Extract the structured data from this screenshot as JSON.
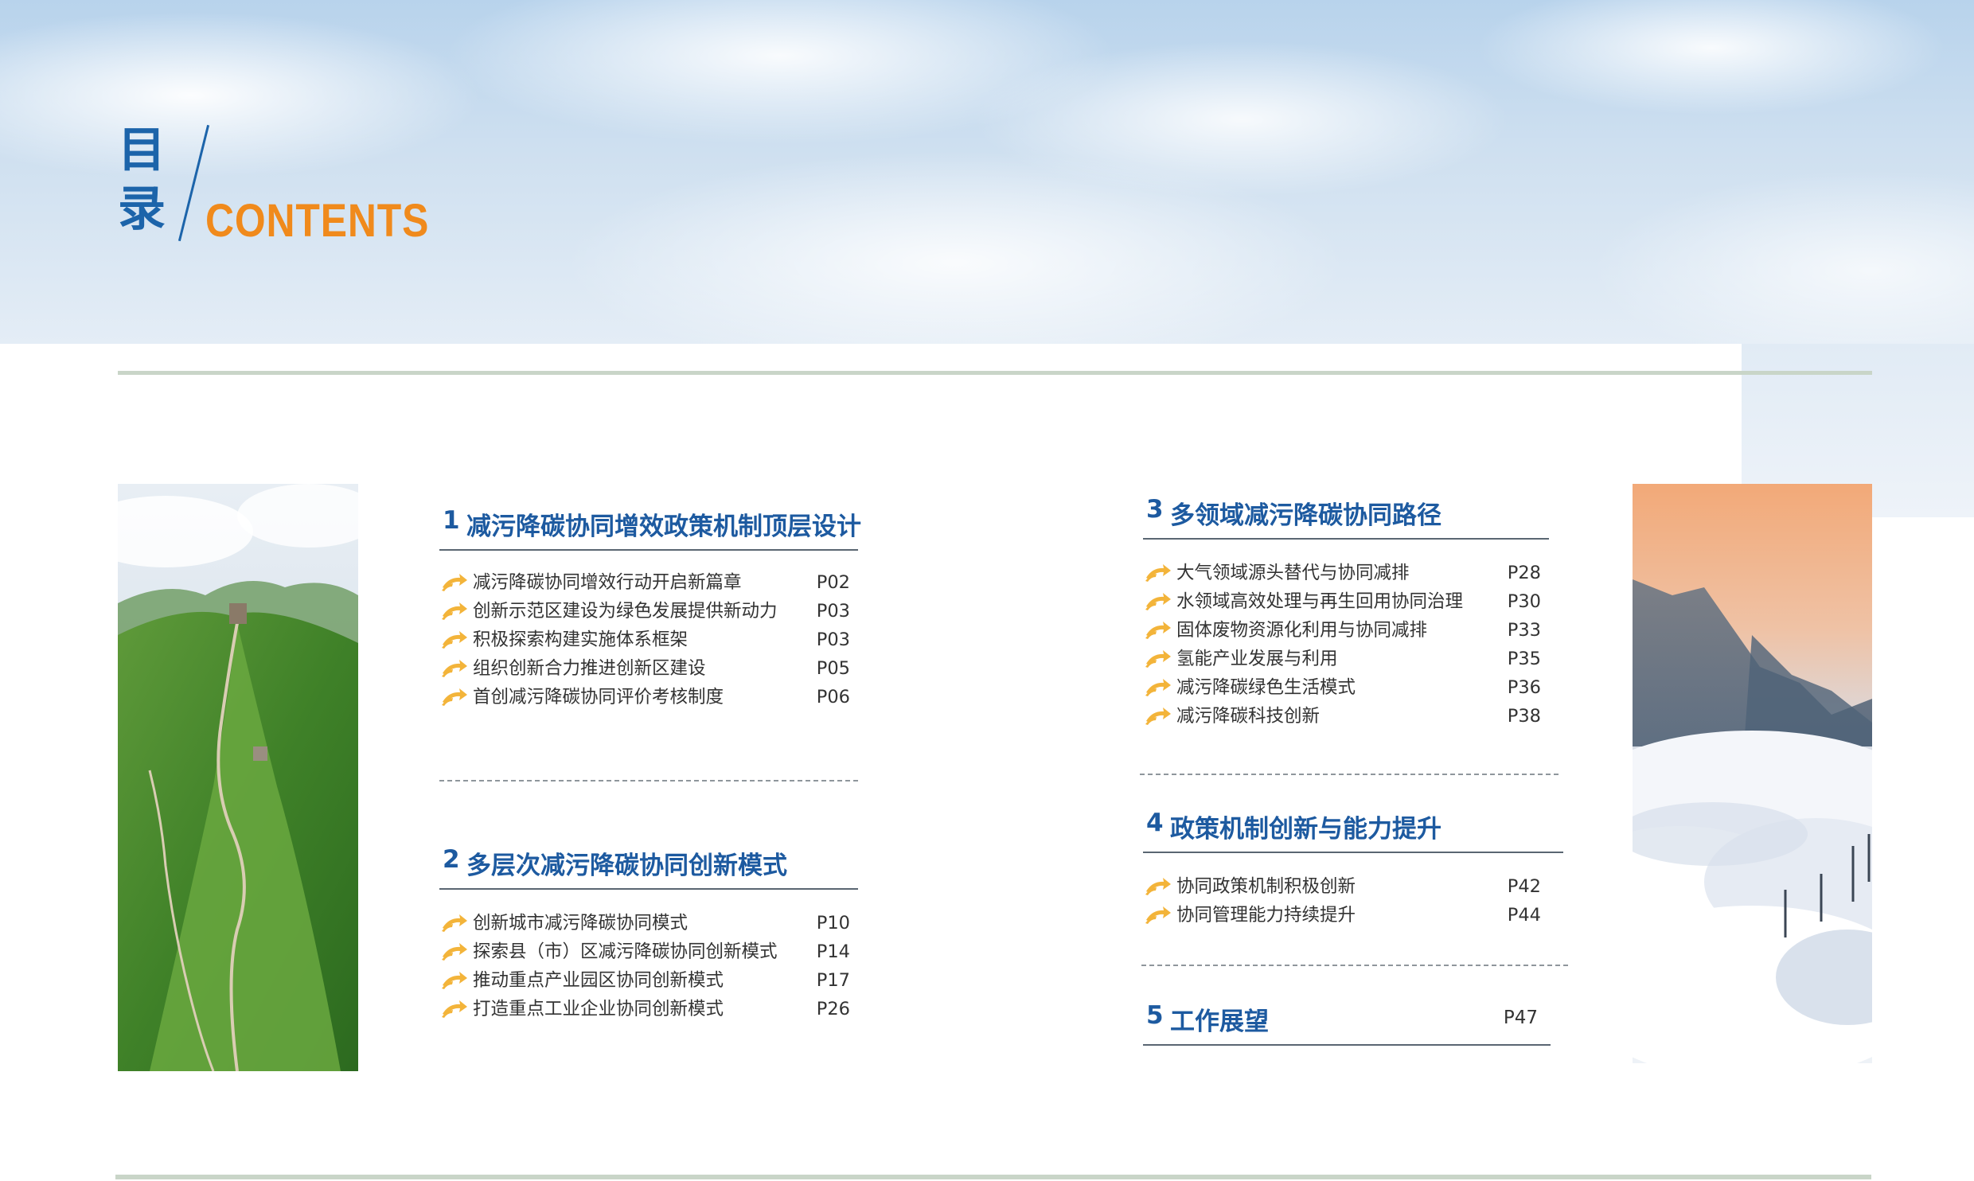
{
  "header": {
    "title_cn_line1": "目",
    "title_cn_line2": "录",
    "title_en": "CONTENTS"
  },
  "colors": {
    "title_blue": "#1c64aa",
    "title_orange": "#f08a1c",
    "section_blue": "#1d5aa0",
    "arrow_yellow": "#f3b43a",
    "rule_green": "#c9d5c8"
  },
  "photos": {
    "left": "mountain-ridge-aerial",
    "right": "sea-of-clouds-wind-turbines"
  },
  "sections": [
    {
      "num": "1",
      "title": "减污降碳协同增效政策机制顶层设计",
      "items": [
        {
          "label": "减污降碳协同增效行动开启新篇章",
          "page": "P02"
        },
        {
          "label": "创新示范区建设为绿色发展提供新动力",
          "page": "P03"
        },
        {
          "label": "积极探索构建实施体系框架",
          "page": "P03"
        },
        {
          "label": "组织创新合力推进创新区建设",
          "page": "P05"
        },
        {
          "label": "首创减污降碳协同评价考核制度",
          "page": "P06"
        }
      ]
    },
    {
      "num": "2",
      "title": "多层次减污降碳协同创新模式",
      "items": [
        {
          "label": "创新城市减污降碳协同模式",
          "page": "P10"
        },
        {
          "label": "探索县（市）区减污降碳协同创新模式",
          "page": "P14"
        },
        {
          "label": "推动重点产业园区协同创新模式",
          "page": "P17"
        },
        {
          "label": "打造重点工业企业协同创新模式",
          "page": "P26"
        }
      ]
    },
    {
      "num": "3",
      "title": "多领域减污降碳协同路径",
      "items": [
        {
          "label": "大气领域源头替代与协同减排",
          "page": "P28"
        },
        {
          "label": "水领域高效处理与再生回用协同治理",
          "page": "P30"
        },
        {
          "label": "固体废物资源化利用与协同减排",
          "page": "P33"
        },
        {
          "label": "氢能产业发展与利用",
          "page": "P35"
        },
        {
          "label": "减污降碳绿色生活模式",
          "page": "P36"
        },
        {
          "label": "减污降碳科技创新",
          "page": "P38"
        }
      ]
    },
    {
      "num": "4",
      "title": "政策机制创新与能力提升",
      "items": [
        {
          "label": "协同政策机制积极创新",
          "page": "P42"
        },
        {
          "label": "协同管理能力持续提升",
          "page": "P44"
        }
      ]
    },
    {
      "num": "5",
      "title": "工作展望",
      "page": "P47",
      "items": []
    }
  ]
}
